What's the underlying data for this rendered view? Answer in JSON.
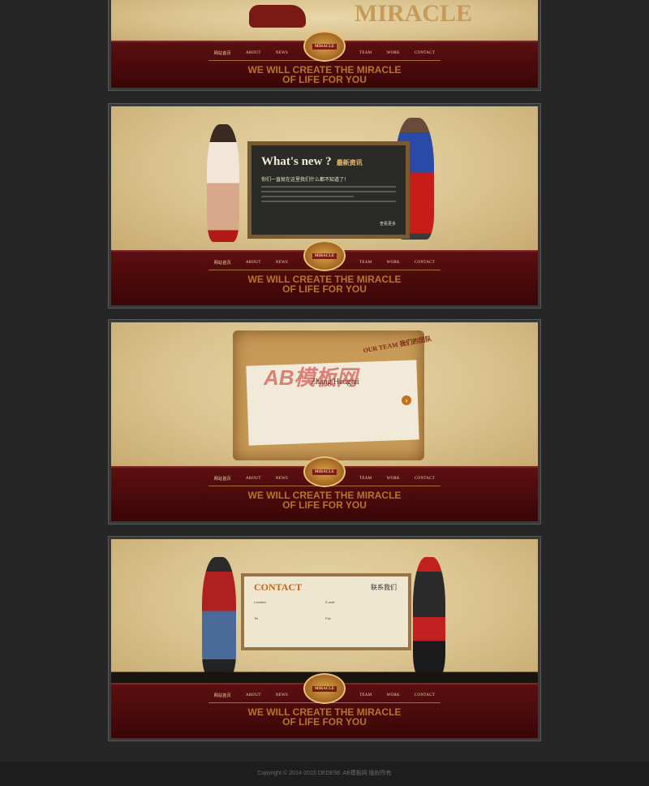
{
  "nav": {
    "items_left": [
      "网站首页",
      "ABOUT",
      "NEWS"
    ],
    "items_right": [
      "TEAM",
      "WORK",
      "CONTACT"
    ],
    "badge": "MIRACLE"
  },
  "tagline": {
    "line1": "WE WILL CREATE THE MIRACLE",
    "line2": "OF LIFE FOR YOU"
  },
  "hero": {
    "sign_text": "MIRACLE"
  },
  "news": {
    "title": "What's new ?",
    "title_cn": "最新资讯",
    "headline": "你们一直就在这里我们什么都不知道了！",
    "more": "查看更多"
  },
  "team": {
    "tag": "OUR TEAM 我们的团队",
    "name": "Zhang Hengtai",
    "watermark": "AB模板网"
  },
  "contact": {
    "title": "CONTACT",
    "title_cn": "联系我们",
    "fields": [
      {
        "label": "Location",
        "value": ""
      },
      {
        "label": "Tel",
        "value": ""
      },
      {
        "label": "E-mail",
        "value": ""
      },
      {
        "label": "Fax",
        "value": ""
      }
    ]
  },
  "footer": {
    "copyright": "Copyright © 2014-2015 DEDE58. AB模板网 版权所有"
  }
}
